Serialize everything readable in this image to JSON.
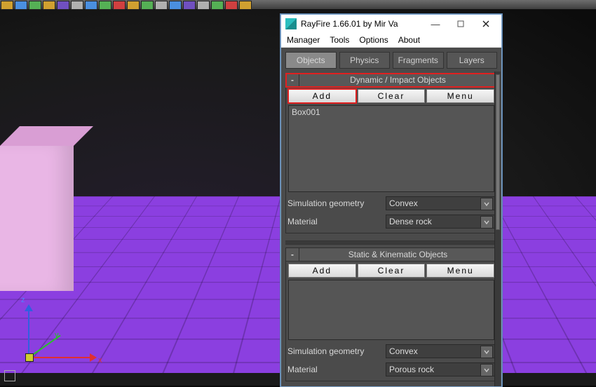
{
  "window": {
    "title": "RayFire 1.66.01  by Mir Va",
    "controls": {
      "min": "—",
      "max": "▢",
      "close": "✕"
    }
  },
  "menu": [
    "Manager",
    "Tools",
    "Options",
    "About"
  ],
  "tabs": [
    {
      "label": "Objects",
      "active": true
    },
    {
      "label": "Physics",
      "active": false
    },
    {
      "label": "Fragments",
      "active": false
    },
    {
      "label": "Layers",
      "active": false
    }
  ],
  "sections": {
    "dynamic": {
      "title": "Dynamic / Impact Objects",
      "collapse": "-",
      "buttons": {
        "add": "Add",
        "clear": "Clear",
        "menu": "Menu"
      },
      "items": [
        "Box001"
      ],
      "sim_geometry": {
        "label": "Simulation geometry",
        "value": "Convex"
      },
      "material": {
        "label": "Material",
        "value": "Dense rock"
      }
    },
    "static": {
      "title": "Static & Kinematic Objects",
      "collapse": "-",
      "buttons": {
        "add": "Add",
        "clear": "Clear",
        "menu": "Menu"
      },
      "items": [],
      "sim_geometry": {
        "label": "Simulation geometry",
        "value": "Convex"
      },
      "material": {
        "label": "Material",
        "value": "Porous rock"
      }
    }
  },
  "gizmo": {
    "x": "x",
    "y": "y",
    "z": "z"
  },
  "toolbar_icon_colors": [
    "#d0a030",
    "#4a8fe0",
    "#55b055",
    "#d0a030",
    "#7050c0",
    "#b0b0b0",
    "#4a8fe0",
    "#55b055",
    "#d04040",
    "#d0a030",
    "#55b055",
    "#b0b0b0",
    "#4a8fe0",
    "#7050c0",
    "#b0b0b0",
    "#55b055",
    "#d04040",
    "#d0a030"
  ]
}
